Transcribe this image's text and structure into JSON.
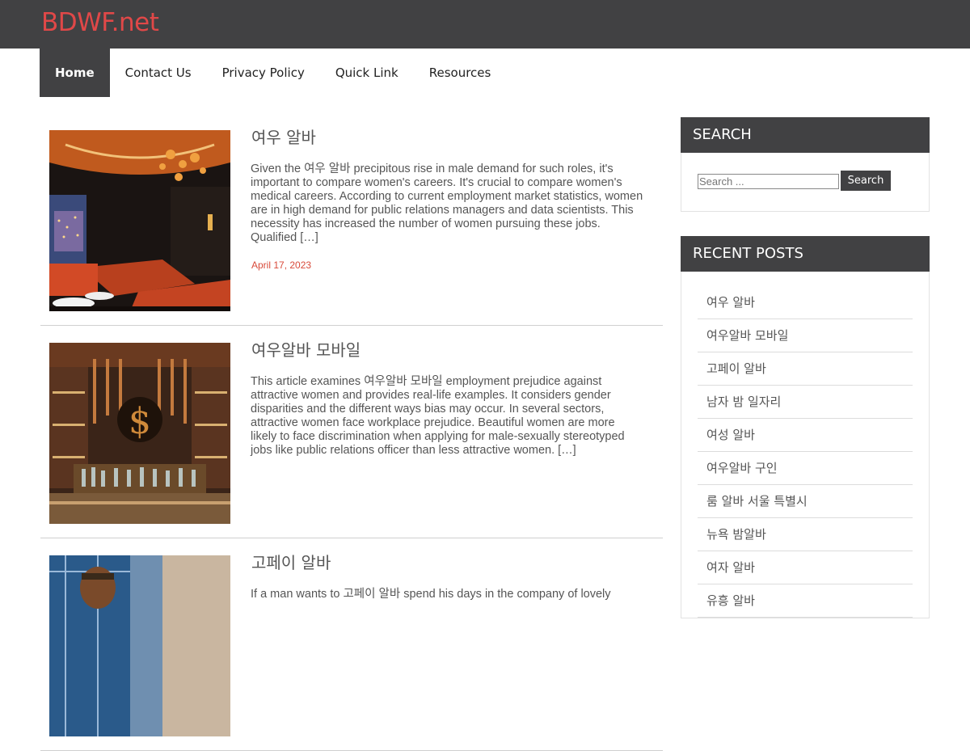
{
  "site": {
    "title": "BDWF.net"
  },
  "nav": {
    "items": [
      "Home",
      "Contact Us",
      "Privacy Policy",
      "Quick Link",
      "Resources"
    ],
    "active": "Home"
  },
  "posts": [
    {
      "title": "여우 알바",
      "excerpt": "Given the 여우 알바 precipitous rise in male demand for such roles, it's important to compare women's careers. It's crucial to compare women's medical careers. According to current employment market statistics, women are in high demand for public relations managers and data scientists. This necessity has increased the number of women pursuing these jobs. Qualified […]",
      "date": "April 17, 2023"
    },
    {
      "title": "여우알바 모바일",
      "excerpt": "This article examines 여우알바 모바일 employment prejudice against attractive women and provides real-life examples. It considers gender disparities and the different ways bias may occur. In several sectors, attractive women face workplace prejudice. Beautiful women are more likely to face discrimination when applying for male-sexually stereotyped jobs like public relations officer than less attractive women. […]",
      "date": ""
    },
    {
      "title": "고페이 알바",
      "excerpt": "If a man wants to 고페이 알바 spend his days in the company of lovely",
      "date": ""
    }
  ],
  "sidebar": {
    "search": {
      "title": "SEARCH",
      "placeholder": "Search ...",
      "button": "Search"
    },
    "recent": {
      "title": "RECENT POSTS",
      "items": [
        "여우 알바",
        "여우알바 모바일",
        "고페이 알바",
        "남자 밤 일자리",
        "여성 알바",
        "여우알바 구인",
        "룸 알바 서울 특별시",
        "뉴욕 밤알바",
        "여자 알바",
        "유흥 알바"
      ]
    }
  },
  "colors": {
    "header_bg": "#414143",
    "brand": "#e04848",
    "date": "#d84a3a"
  }
}
